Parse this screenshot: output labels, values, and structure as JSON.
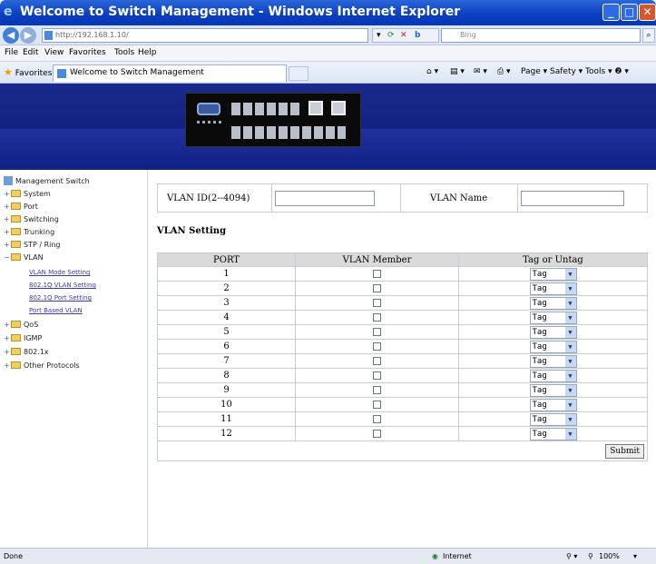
{
  "window": {
    "title": "Welcome to Switch Management - Windows Internet Explorer",
    "min_glyph": "_",
    "max_glyph": "□",
    "close_glyph": "✕"
  },
  "addressbar": {
    "url": "http://192.168.1.10/",
    "search_placeholder": "Bing"
  },
  "menu": [
    "File",
    "Edit",
    "View",
    "Favorites",
    "Tools",
    "Help"
  ],
  "favbar": {
    "favorites_label": "Favorites",
    "tab_title": "Welcome to Switch Management",
    "commands": "Page ▾   Safety ▾   Tools ▾   ❷ ▾"
  },
  "sidebar": {
    "root": "Management Switch",
    "items": [
      {
        "label": "System",
        "toggle": "+"
      },
      {
        "label": "Port",
        "toggle": "+"
      },
      {
        "label": "Switching",
        "toggle": "+"
      },
      {
        "label": "Trunking",
        "toggle": "+"
      },
      {
        "label": "STP / Ring",
        "toggle": "+"
      },
      {
        "label": "VLAN",
        "toggle": "−"
      },
      {
        "label": "QoS",
        "toggle": "+"
      },
      {
        "label": "IGMP",
        "toggle": "+"
      },
      {
        "label": "802.1x",
        "toggle": "+"
      },
      {
        "label": "Other Protocols",
        "toggle": "+"
      }
    ],
    "vlan_links": [
      "VLAN Mode Setting",
      "802.1Q VLAN Setting",
      "802.1Q Port Setting",
      "Port Based VLAN"
    ]
  },
  "form": {
    "vlan_id_label": "VLAN ID(2--4094)",
    "vlan_id_value": "",
    "vlan_name_label": "VLAN Name",
    "vlan_name_value": "",
    "section_title": "VLAN Setting",
    "columns": [
      "PORT",
      "VLAN Member",
      "Tag or Untag"
    ],
    "rows": [
      {
        "port": "1",
        "member": false,
        "tag": "Tag"
      },
      {
        "port": "2",
        "member": false,
        "tag": "Tag"
      },
      {
        "port": "3",
        "member": false,
        "tag": "Tag"
      },
      {
        "port": "4",
        "member": false,
        "tag": "Tag"
      },
      {
        "port": "5",
        "member": false,
        "tag": "Tag"
      },
      {
        "port": "6",
        "member": false,
        "tag": "Tag"
      },
      {
        "port": "7",
        "member": false,
        "tag": "Tag"
      },
      {
        "port": "8",
        "member": false,
        "tag": "Tag"
      },
      {
        "port": "9",
        "member": false,
        "tag": "Tag"
      },
      {
        "port": "10",
        "member": false,
        "tag": "Tag"
      },
      {
        "port": "11",
        "member": false,
        "tag": "Tag"
      },
      {
        "port": "12",
        "member": false,
        "tag": "Tag"
      }
    ],
    "submit_label": "Submit"
  },
  "statusbar": {
    "status": "Done",
    "zone": "Internet",
    "zoom": "100%"
  },
  "colors": {
    "titlebar": "#0a3cc2",
    "banner": "#1a2a8c",
    "header_row": "#dadada",
    "link": "#3a3ab4"
  }
}
